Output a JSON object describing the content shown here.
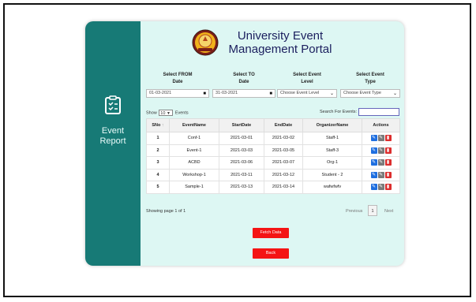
{
  "sidebar": {
    "icon": "clipboard-checklist-icon",
    "label_line1": "Event",
    "label_line2": "Report"
  },
  "header": {
    "logo": "university-seal-icon",
    "title_line1": "University Event",
    "title_line2": "Management Portal"
  },
  "filters": {
    "from_label_1": "Select FROM",
    "from_label_2": "Date",
    "from_value": "01-03-2021",
    "to_label_1": "Select TO",
    "to_label_2": "Date",
    "to_value": "31-03-2021",
    "level_label_1": "Select Event",
    "level_label_2": "Level",
    "level_value": "Choose Event Level",
    "type_label_1": "Select Event",
    "type_label_2": "Type",
    "type_value": "Choose Event Type",
    "calendar_icon": "calendar-icon",
    "chevron_icon": "chevron-down-icon"
  },
  "table_tools": {
    "show_label": "Show",
    "show_value": "10",
    "entries_label": "Events",
    "search_label": "Search For Events:"
  },
  "table": {
    "headers": [
      "SNo",
      "EventName",
      "StartDate",
      "EndDate",
      "OrganizerName",
      "Actions"
    ],
    "rows": [
      {
        "sno": "1",
        "name": "Conf-1",
        "start": "2021-03-01",
        "end": "2021-03-02",
        "org": "Staff-1"
      },
      {
        "sno": "2",
        "name": "Event-1",
        "start": "2021-03-03",
        "end": "2021-03-05",
        "org": "Staff-3"
      },
      {
        "sno": "3",
        "name": "ACBD",
        "start": "2021-03-06",
        "end": "2021-03-07",
        "org": "Org-1"
      },
      {
        "sno": "4",
        "name": "Workshop-1",
        "start": "2021-03-11",
        "end": "2021-03-12",
        "org": "Student - 2"
      },
      {
        "sno": "5",
        "name": "Sample-1",
        "start": "2021-03-13",
        "end": "2021-03-14",
        "org": "wafwfwfv"
      }
    ],
    "action_icons": [
      "view-icon",
      "edit-icon",
      "delete-icon"
    ]
  },
  "pagination": {
    "info": "Showing page 1 of 1",
    "previous": "Previous",
    "page": "1",
    "next": "Next"
  },
  "buttons": {
    "fetch": "Fetch Data",
    "back": "Back"
  },
  "colors": {
    "sidebar": "#177a76",
    "card": "#ddf7f3",
    "title": "#1b1f5e",
    "button": "#f41414",
    "view": "#1f6fe0",
    "edit": "#7a7a7a",
    "delete": "#dc2e2e"
  }
}
